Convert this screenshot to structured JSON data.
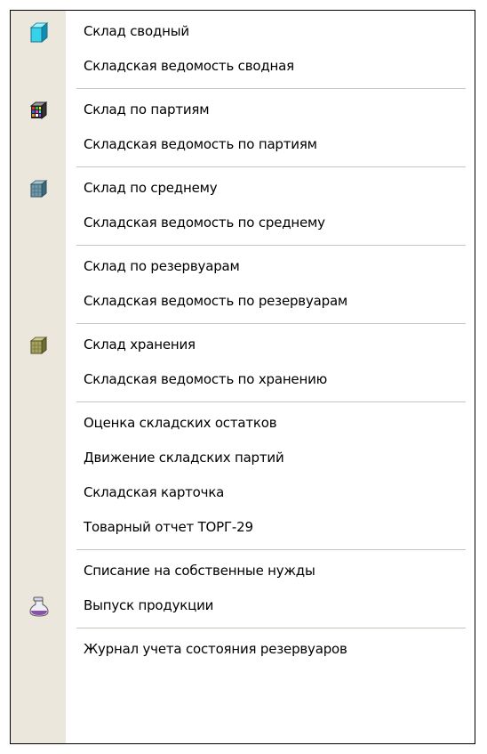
{
  "menu": {
    "items": [
      {
        "label": "Склад сводный",
        "icon": "cyan-cube-icon"
      },
      {
        "label": "Складская ведомость сводная"
      },
      {
        "label": "Склад по партиям",
        "icon": "colorful-cube-icon"
      },
      {
        "label": "Складская ведомость по партиям"
      },
      {
        "label": "Склад по среднему",
        "icon": "blue-grid-cube-icon"
      },
      {
        "label": "Складская ведомость по среднему"
      },
      {
        "label": "Склад по резервуарам"
      },
      {
        "label": "Складская ведомость по резервуарам"
      },
      {
        "label": "Склад хранения",
        "icon": "olive-grid-cube-icon"
      },
      {
        "label": "Складская ведомость по хранению"
      },
      {
        "label": "Оценка складских остатков"
      },
      {
        "label": "Движение складских партий"
      },
      {
        "label": "Складская карточка"
      },
      {
        "label": "Товарный отчет ТОРГ-29"
      },
      {
        "label": "Списание на собственные нужды"
      },
      {
        "label": "Выпуск продукции",
        "icon": "flask-icon"
      },
      {
        "label": "Журнал учета состояния резервуаров"
      }
    ]
  }
}
